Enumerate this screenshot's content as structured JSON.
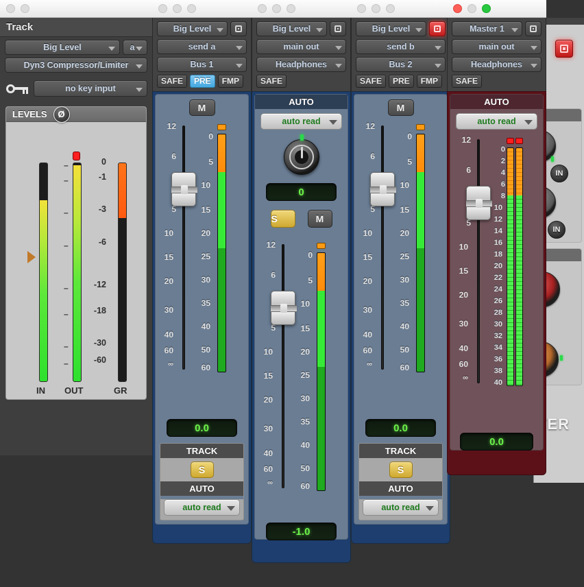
{
  "background_plugin": {
    "word": "TER",
    "in_buttons": [
      "IN",
      "IN"
    ],
    "record_button": "record-enable"
  },
  "plugin_window": {
    "titlebar_dots": [
      "grey",
      "grey"
    ],
    "header": "Track",
    "track_select": "Big Level",
    "track_suffix": "a",
    "plugin_select": "Dyn3 Compressor/Limiter",
    "key_input_label": "no key input",
    "key_input": "no key input",
    "levels": {
      "title": "LEVELS",
      "phase_glyph": "Ø",
      "scale": [
        "0",
        "-1",
        "-3",
        "-6",
        "-12",
        "-18",
        "-30",
        "-60"
      ],
      "captions": [
        "IN",
        "OUT",
        "GR"
      ],
      "in_level_db": -3.0,
      "out_level_db": -0.4,
      "out_clip": true,
      "gr_db": -6.0,
      "threshold_marker_db": -7.0
    }
  },
  "strips": [
    {
      "id": "send-a",
      "titlebar_dots": [
        "grey",
        "grey",
        "grey"
      ],
      "track": "Big Level",
      "output": "send a",
      "path": "Bus 1",
      "tags": [
        {
          "label": "SAFE",
          "active": false
        },
        {
          "label": "PRE",
          "active": true
        },
        {
          "label": "FMP",
          "active": false
        }
      ],
      "rec_armed": false,
      "mute_label": "M",
      "fader_scale": [
        "12",
        "6",
        "0",
        "5",
        "10",
        "15",
        "20",
        "30",
        "40",
        "60",
        "∞"
      ],
      "meter_scale": [
        "0",
        "5",
        "10",
        "15",
        "20",
        "25",
        "30",
        "35",
        "40",
        "50",
        "60"
      ],
      "fader_value": "0.0",
      "meter_db": -1.5,
      "clip_color": "orange",
      "track_section": {
        "header": "TRACK",
        "solo_label": "S",
        "solo_on": true
      },
      "auto_section": {
        "header": "AUTO",
        "mode": "auto read"
      }
    },
    {
      "id": "main-out-headphones",
      "titlebar_dots": [
        "grey",
        "grey",
        "grey"
      ],
      "track": "Big Level",
      "output": "main out",
      "path": "Headphones",
      "tags": [
        {
          "label": "SAFE",
          "active": false
        }
      ],
      "rec_armed": false,
      "auto_header": "AUTO",
      "auto_mode": "auto read",
      "pan_value": "0",
      "solo_label": "S",
      "solo_on": true,
      "mute_label": "M",
      "mute_on": false,
      "fader_scale": [
        "12",
        "6",
        "0",
        "5",
        "10",
        "15",
        "20",
        "30",
        "40",
        "60",
        "∞"
      ],
      "meter_scale": [
        "0",
        "5",
        "10",
        "15",
        "20",
        "25",
        "30",
        "35",
        "40",
        "50",
        "60"
      ],
      "fader_value": "-1.0",
      "meter_db": -1.5,
      "clip_color": "orange"
    },
    {
      "id": "send-b",
      "titlebar_dots": [
        "grey",
        "grey",
        "grey"
      ],
      "track": "Big Level",
      "output": "send b",
      "path": "Bus 2",
      "tags": [
        {
          "label": "SAFE",
          "active": false
        },
        {
          "label": "PRE",
          "active": false
        },
        {
          "label": "FMP",
          "active": false
        }
      ],
      "rec_armed": true,
      "mute_label": "M",
      "fader_scale": [
        "12",
        "6",
        "0",
        "5",
        "10",
        "15",
        "20",
        "30",
        "40",
        "60",
        "∞"
      ],
      "meter_scale": [
        "0",
        "5",
        "10",
        "15",
        "20",
        "25",
        "30",
        "35",
        "40",
        "50",
        "60"
      ],
      "fader_value": "0.0",
      "meter_db": -1.5,
      "clip_color": "orange",
      "track_section": {
        "header": "TRACK",
        "solo_label": "S",
        "solo_on": true
      },
      "auto_section": {
        "header": "AUTO",
        "mode": "auto read"
      }
    },
    {
      "id": "master-1",
      "titlebar_dots": [
        "red",
        "grey",
        "green"
      ],
      "track": "Master 1",
      "output": "main out",
      "path": "Headphones",
      "tags": [
        {
          "label": "SAFE",
          "active": false
        }
      ],
      "rec_armed": false,
      "auto_header": "AUTO",
      "auto_mode": "auto read",
      "fader_scale": [
        "12",
        "6",
        "0",
        "5",
        "10",
        "15",
        "20",
        "30",
        "40",
        "60",
        "∞"
      ],
      "meter_scale": [
        "0",
        "2",
        "4",
        "6",
        "8",
        "10",
        "12",
        "14",
        "16",
        "18",
        "20",
        "22",
        "24",
        "26",
        "28",
        "30",
        "32",
        "34",
        "36",
        "38",
        "40"
      ],
      "fader_value": "0.0",
      "meter_db": -8,
      "clip_color": "red",
      "stereo": true
    }
  ],
  "colors": {
    "strip_blue": "#1d3e6e",
    "strip_panel": "#6a7d93",
    "master_red": "#5c1118",
    "master_panel": "#70535a",
    "lcd_green": "#6cf24a",
    "solo_yellow": "#cfa830",
    "meter_green": "#2ee02e",
    "meter_orange": "#ff9a12"
  }
}
